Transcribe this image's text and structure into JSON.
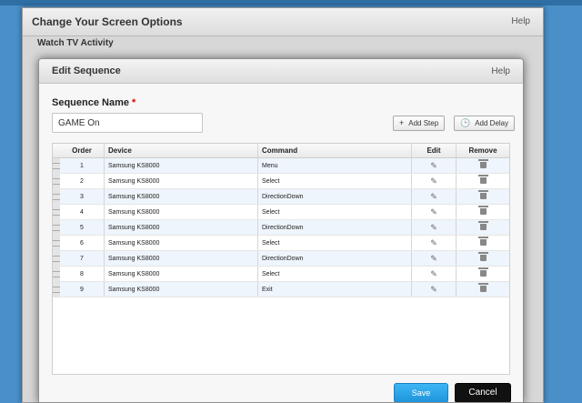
{
  "outer_dialog": {
    "title": "Change Your Screen Options",
    "help": "Help",
    "subtitle": "Watch TV Activity"
  },
  "dialog": {
    "title": "Edit Sequence",
    "help": "Help"
  },
  "form": {
    "sequence_label": "Sequence Name",
    "required_marker": "*",
    "sequence_value": "GAME On"
  },
  "buttons": {
    "add_step": "Add Step",
    "add_delay": "Add Delay",
    "save": "Save",
    "cancel": "Cancel"
  },
  "table": {
    "headers": {
      "order": "Order",
      "device": "Device",
      "command": "Command",
      "edit": "Edit",
      "remove": "Remove"
    },
    "rows": [
      {
        "order": "1",
        "device": "Samsung KS8000",
        "command": "Menu"
      },
      {
        "order": "2",
        "device": "Samsung KS8000",
        "command": "Select"
      },
      {
        "order": "3",
        "device": "Samsung KS8000",
        "command": "DirectionDown"
      },
      {
        "order": "4",
        "device": "Samsung KS8000",
        "command": "Select"
      },
      {
        "order": "5",
        "device": "Samsung KS8000",
        "command": "DirectionDown"
      },
      {
        "order": "6",
        "device": "Samsung KS8000",
        "command": "Select"
      },
      {
        "order": "7",
        "device": "Samsung KS8000",
        "command": "DirectionDown"
      },
      {
        "order": "8",
        "device": "Samsung KS8000",
        "command": "Select"
      },
      {
        "order": "9",
        "device": "Samsung KS8000",
        "command": "Exit"
      }
    ]
  },
  "icons": {
    "add_step": "plus-icon",
    "add_delay": "clock-icon",
    "edit": "pencil-icon",
    "remove": "trash-icon",
    "row_handle": "drag-handle-icon"
  },
  "colors": {
    "save_button": "#29a3e8",
    "cancel_button": "#111111",
    "row_alt": "#eef5fc",
    "required": "#dd0000"
  }
}
